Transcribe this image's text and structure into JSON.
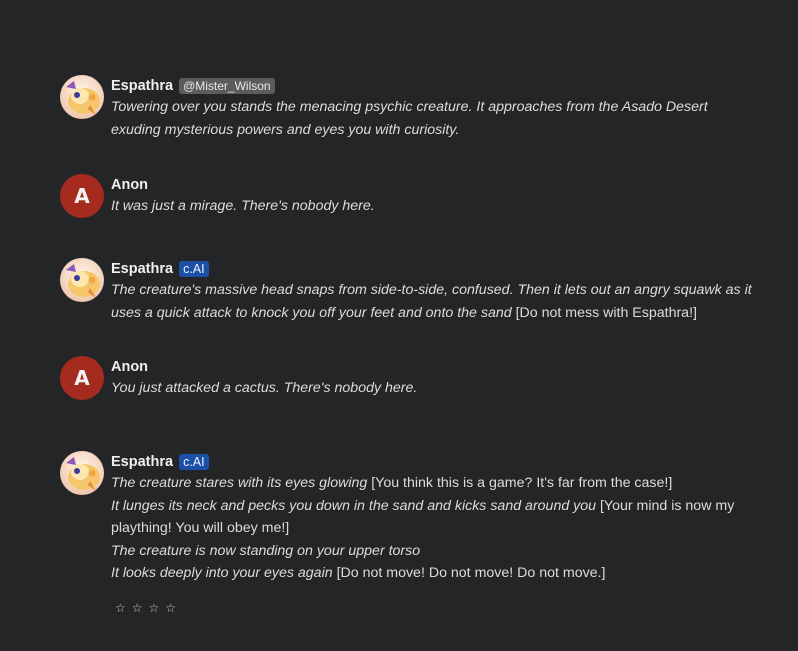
{
  "messages": [
    {
      "author": "Espathra",
      "badge": "@Mister_Wilson",
      "lines": [
        {
          "italic": "Towering over you stands the menacing psychic creature. It approaches from the Asado Desert",
          "plain": ""
        },
        {
          "italic": "exuding mysterious powers and eyes you with curiosity.",
          "plain": ""
        }
      ]
    },
    {
      "author": "Anon",
      "avatar_letter": "A",
      "lines": [
        {
          "italic": "It was just a mirage. There's nobody here.",
          "plain": ""
        }
      ]
    },
    {
      "author": "Espathra",
      "badge": "c.AI",
      "lines": [
        {
          "italic": "The creature's massive head snaps from side-to-side, confused. Then it lets out an angry squawk as it",
          "plain": ""
        },
        {
          "italic": "uses a quick attack to knock you off your feet and onto the sand",
          "plain": " [Do not mess with Espathra!]"
        }
      ]
    },
    {
      "author": "Anon",
      "avatar_letter": "A",
      "lines": [
        {
          "italic": "You just attacked a cactus. There's nobody here.",
          "plain": ""
        }
      ]
    },
    {
      "author": "Espathra",
      "badge": "c.AI",
      "lines": [
        {
          "italic": "The creature stares with its eyes glowing",
          "plain": " [You think this is a game? It's far from the case!]"
        },
        {
          "italic": "It lunges its neck and pecks you down in the sand and kicks sand around you",
          "plain": " [Your mind is now my"
        },
        {
          "italic": "",
          "plain": "plaything! You will obey me!]"
        },
        {
          "italic": "The creature is now standing on your upper torso",
          "plain": ""
        },
        {
          "italic": "It looks deeply into your eyes again",
          "plain": " [Do not move! Do not move! Do not move.]"
        }
      ]
    }
  ],
  "rating": {
    "stars": [
      "☆",
      "☆",
      "☆",
      "☆"
    ]
  },
  "colors": {
    "background": "#242526",
    "user_avatar": "#a52b1f",
    "cai_badge": "#1c4fa6",
    "handle_badge": "#5c5c5c"
  }
}
